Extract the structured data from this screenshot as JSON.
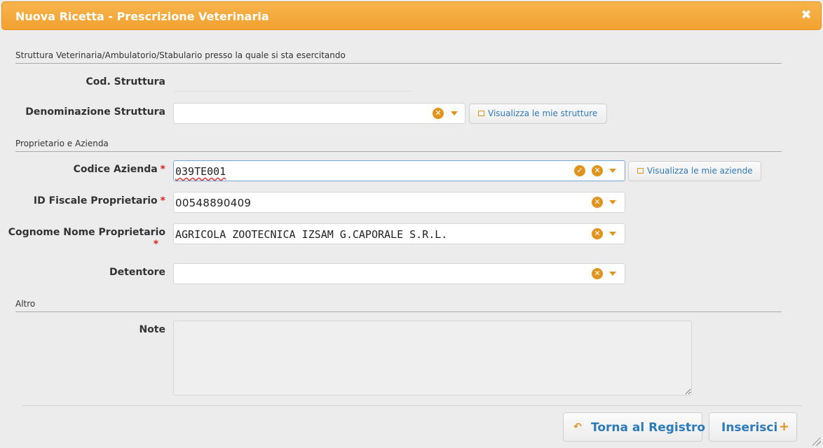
{
  "dialog": {
    "title": "Nuova Ricetta - Prescrizione Veterinaria",
    "close_icon": "close-icon"
  },
  "sections": {
    "structure": "Struttura Veterinaria/Ambulatorio/Stabulario presso la quale si sta esercitando",
    "owner": "Proprietario e Azienda",
    "other": "Altro"
  },
  "fields": {
    "cod_struttura": {
      "label": "Cod. Struttura",
      "value": ""
    },
    "denominazione": {
      "label": "Denominazione Struttura",
      "value": "",
      "link": "Visualizza le mie strutture"
    },
    "codice_azienda": {
      "label": "Codice Azienda",
      "required": "*",
      "value": "039TE001",
      "link": "Visualizza le mie aziende"
    },
    "id_fiscale": {
      "label": "ID Fiscale Proprietario",
      "required": "*",
      "value": "00548890409"
    },
    "cognome_nome": {
      "label": "Cognome Nome Proprietario",
      "required": "*",
      "value": "AGRICOLA ZOOTECNICA IZSAM G.CAPORALE S.R.L."
    },
    "detentore": {
      "label": "Detentore",
      "value": ""
    },
    "note": {
      "label": "Note",
      "value": ""
    }
  },
  "buttons": {
    "back": "Torna al Registro",
    "insert": "Inserisci"
  },
  "colors": {
    "accent": "#f2a230",
    "icon": "#e0941e",
    "link": "#2d7ab8"
  }
}
